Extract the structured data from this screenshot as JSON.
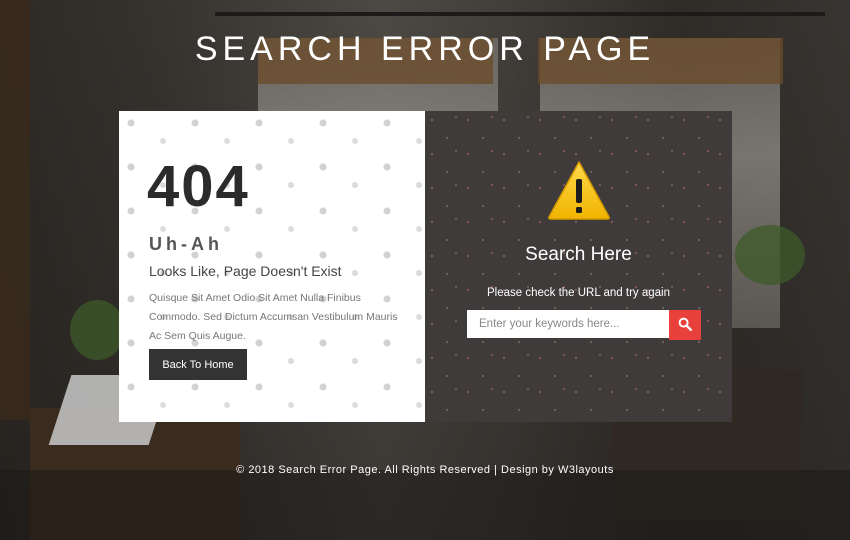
{
  "page": {
    "title": "SEARCH ERROR PAGE"
  },
  "error_panel": {
    "code": "404",
    "exclamation": "Uh-Ah",
    "message": "Looks Like, Page Doesn't Exist",
    "description": "Quisque Sit Amet Odio Sit Amet Nulla Finibus Commodo. Sed Dictum Accumsan Vestibulum Mauris Ac Sem Quis Augue.",
    "home_button": "Back To Home"
  },
  "search_panel": {
    "icon": "warning-triangle-icon",
    "title": "Search Here",
    "subtitle": "Please check the URL and try again",
    "placeholder": "Enter your keywords here...",
    "search_button_icon": "search-icon"
  },
  "footer": {
    "text": "© 2018 Search Error Page. All Rights Reserved | Design by W3layouts"
  },
  "colors": {
    "accent": "#e8403a",
    "warning": "#f7c600",
    "dark_panel": "#3f3b3a",
    "button_dark": "#333333"
  }
}
